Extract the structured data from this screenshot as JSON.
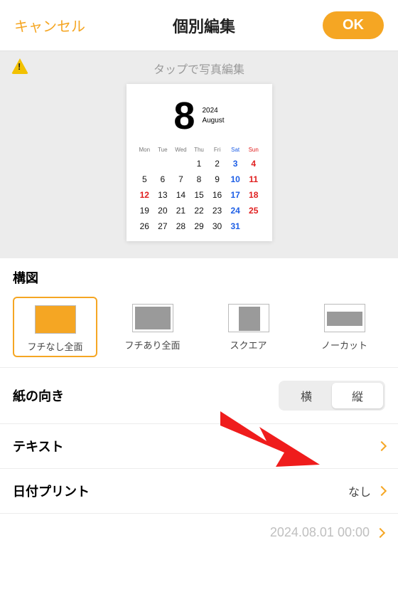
{
  "header": {
    "cancel": "キャンセル",
    "title": "個別編集",
    "ok": "OK"
  },
  "preview": {
    "hint": "タップで写真編集",
    "calendar": {
      "month_num": "8",
      "year": "2024",
      "month_name": "August",
      "dow": [
        "Mon",
        "Tue",
        "Wed",
        "Thu",
        "Fri",
        "Sat",
        "Sun"
      ],
      "offset": 3,
      "holiday_dates": [
        11,
        12
      ],
      "days_in_month": 31
    }
  },
  "composition": {
    "title": "構図",
    "options": [
      {
        "label": "フチなし全面",
        "style": "t-full",
        "selected": true
      },
      {
        "label": "フチあり全面",
        "style": "t-border",
        "selected": false
      },
      {
        "label": "スクエア",
        "style": "t-square",
        "selected": false
      },
      {
        "label": "ノーカット",
        "style": "t-nocut",
        "selected": false
      }
    ]
  },
  "orientation": {
    "label": "紙の向き",
    "options": [
      "横",
      "縦"
    ],
    "selected": "縦"
  },
  "text_row": {
    "label": "テキスト"
  },
  "date_print": {
    "label": "日付プリント",
    "value": "なし"
  },
  "timestamp": "2024.08.01 00:00"
}
